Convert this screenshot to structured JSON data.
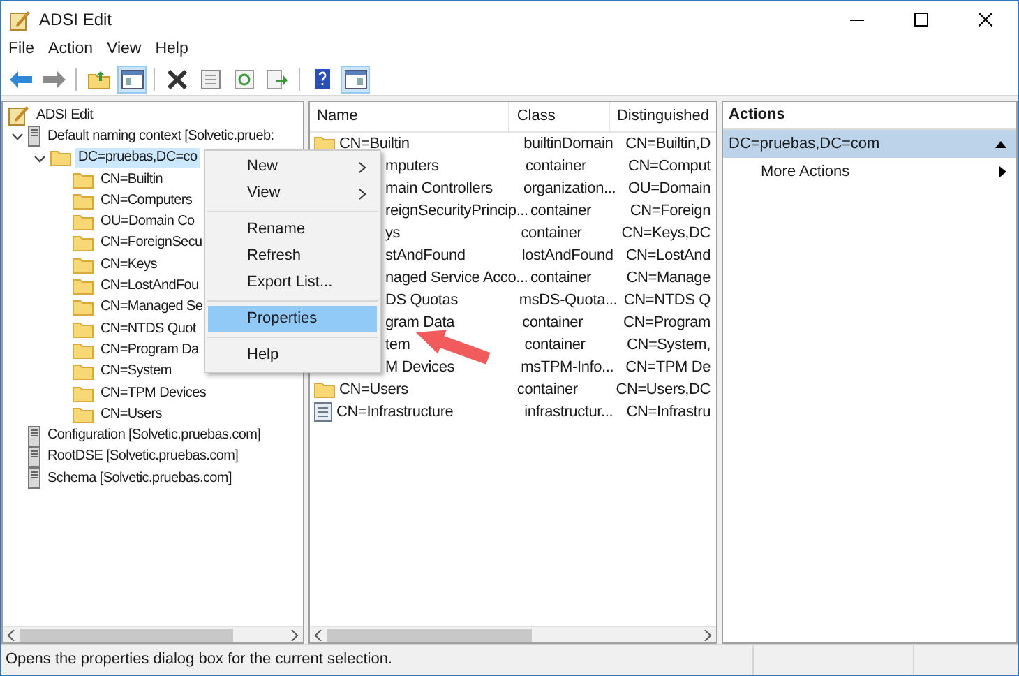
{
  "window": {
    "title": "ADSI Edit"
  },
  "menu": [
    "File",
    "Action",
    "View",
    "Help"
  ],
  "toolbar": [
    {
      "kind": "back",
      "pressed": false
    },
    {
      "kind": "forward",
      "pressed": false
    },
    {
      "kind": "sep"
    },
    {
      "kind": "up",
      "pressed": false
    },
    {
      "kind": "tree",
      "pressed": true
    },
    {
      "kind": "sep"
    },
    {
      "kind": "delete",
      "pressed": false
    },
    {
      "kind": "props",
      "pressed": false
    },
    {
      "kind": "refresh",
      "pressed": false
    },
    {
      "kind": "export",
      "pressed": false
    },
    {
      "kind": "sep"
    },
    {
      "kind": "help",
      "pressed": false
    },
    {
      "kind": "actions",
      "pressed": true
    }
  ],
  "tree": [
    {
      "label": "ADSI Edit",
      "kind": "root",
      "children": [
        {
          "label": "Default naming context [Solvetic.prueb:",
          "kind": "server",
          "expanded": true,
          "children": [
            {
              "label": "DC=pruebas,DC=co",
              "kind": "folder",
              "expanded": true,
              "selected": true,
              "children": [
                {
                  "label": "CN=Builtin",
                  "kind": "folder",
                  "selected": false
                },
                {
                  "label": "CN=Computers",
                  "kind": "folder",
                  "selected": false
                },
                {
                  "label": "OU=Domain Co",
                  "kind": "folder",
                  "selected": false
                },
                {
                  "label": "CN=ForeignSecu",
                  "kind": "folder",
                  "selected": false
                },
                {
                  "label": "CN=Keys",
                  "kind": "folder",
                  "selected": false
                },
                {
                  "label": "CN=LostAndFou",
                  "kind": "folder",
                  "selected": false
                },
                {
                  "label": "CN=Managed Se",
                  "kind": "folder",
                  "selected": false
                },
                {
                  "label": "CN=NTDS Quot",
                  "kind": "folder",
                  "selected": false
                },
                {
                  "label": "CN=Program Da",
                  "kind": "folder",
                  "selected": false
                },
                {
                  "label": "CN=System",
                  "kind": "folder",
                  "selected": false
                },
                {
                  "label": "CN=TPM Devices",
                  "kind": "folder",
                  "selected": false
                },
                {
                  "label": "CN=Users",
                  "kind": "folder",
                  "selected": false
                }
              ]
            }
          ]
        },
        {
          "label": "Configuration [Solvetic.pruebas.com]",
          "kind": "server",
          "selected": false
        },
        {
          "label": "RootDSE [Solvetic.pruebas.com]",
          "kind": "server",
          "selected": false
        },
        {
          "label": "Schema [Solvetic.pruebas.com]",
          "kind": "server",
          "selected": false
        }
      ]
    }
  ],
  "list": {
    "columns": [
      "Name",
      "Class",
      "Distinguished"
    ],
    "rows": [
      {
        "name": "CN=Builtin",
        "class": "builtinDomain",
        "dn": "CN=Builtin,D",
        "kind": "folder"
      },
      {
        "name": "mputers",
        "class": "container",
        "dn": "CN=Comput",
        "kind": "covered"
      },
      {
        "name": "main Controllers",
        "class": "organization...",
        "dn": "OU=Domain",
        "kind": "covered"
      },
      {
        "name": "reignSecurityPrincip...",
        "class": "container",
        "dn": "CN=Foreign",
        "kind": "covered"
      },
      {
        "name": "ys",
        "class": "container",
        "dn": "CN=Keys,DC",
        "kind": "covered"
      },
      {
        "name": "stAndFound",
        "class": "lostAndFound",
        "dn": "CN=LostAnd",
        "kind": "covered"
      },
      {
        "name": "naged Service Acco...",
        "class": "container",
        "dn": "CN=Manage",
        "kind": "covered"
      },
      {
        "name": "DS Quotas",
        "class": "msDS-Quota...",
        "dn": "CN=NTDS Q",
        "kind": "covered"
      },
      {
        "name": "gram Data",
        "class": "container",
        "dn": "CN=Program",
        "kind": "covered"
      },
      {
        "name": "tem",
        "class": "container",
        "dn": "CN=System,",
        "kind": "covered"
      },
      {
        "name": "M Devices",
        "class": "msTPM-Info...",
        "dn": "CN=TPM De",
        "kind": "covered"
      },
      {
        "name": "CN=Users",
        "class": "container",
        "dn": "CN=Users,DC",
        "kind": "folder"
      },
      {
        "name": "CN=Infrastructure",
        "class": "infrastructur...",
        "dn": "CN=Infrastru",
        "kind": "object"
      }
    ]
  },
  "actions": {
    "title": "Actions",
    "section": "DC=pruebas,DC=com",
    "items": [
      "More Actions"
    ]
  },
  "context_menu": [
    {
      "label": "New",
      "submenu": true,
      "selected": false
    },
    {
      "label": "View",
      "submenu": true,
      "selected": false
    },
    {
      "kind": "sep"
    },
    {
      "label": "Rename",
      "submenu": false,
      "selected": false
    },
    {
      "label": "Refresh",
      "submenu": false,
      "selected": false
    },
    {
      "label": "Export List...",
      "submenu": false,
      "selected": false
    },
    {
      "kind": "sep"
    },
    {
      "label": "Properties",
      "submenu": false,
      "selected": true
    },
    {
      "kind": "sep"
    },
    {
      "label": "Help",
      "submenu": false,
      "selected": false
    }
  ],
  "status_bar": "Opens the properties dialog box for the current selection."
}
